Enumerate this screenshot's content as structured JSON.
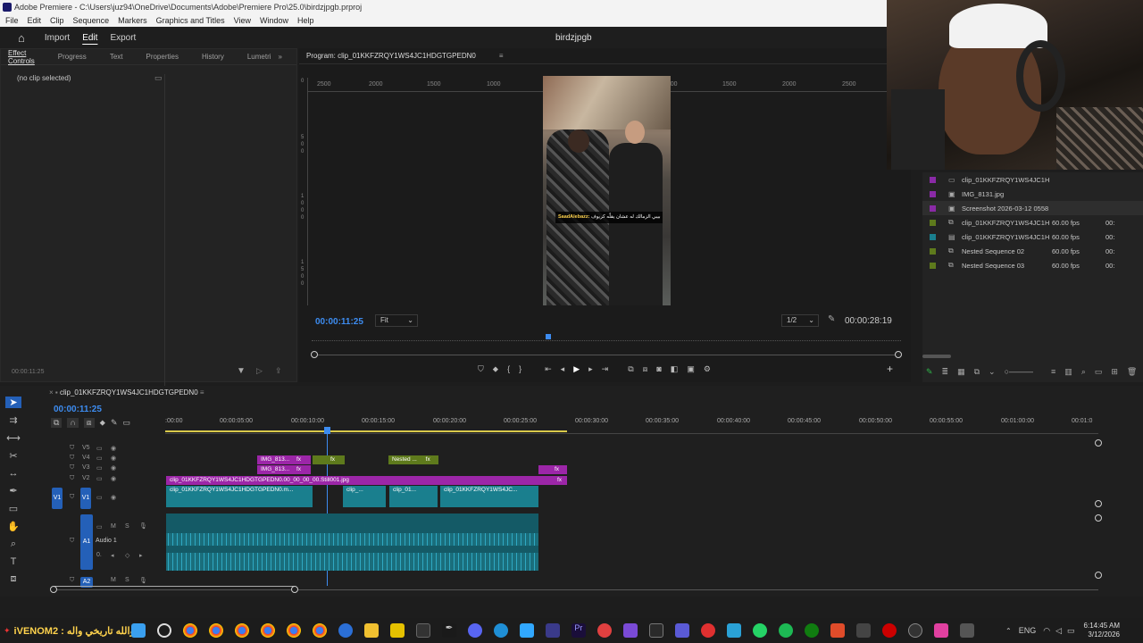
{
  "window": {
    "title": "Adobe Premiere - C:\\Users\\juz94\\OneDrive\\Documents\\Adobe\\Premiere Pro\\25.0\\birdzjpgb.prproj",
    "menu": [
      "File",
      "Edit",
      "Clip",
      "Sequence",
      "Markers",
      "Graphics and Titles",
      "View",
      "Window",
      "Help"
    ]
  },
  "topnav": {
    "import": "Import",
    "edit": "Edit",
    "export": "Export",
    "project_name": "birdzjpgb"
  },
  "left_panel": {
    "tabs": [
      "Effect Controls",
      "Progress",
      "Text",
      "Properties",
      "History",
      "Lumetri"
    ],
    "no_clip": "(no clip selected)",
    "timecode": "00:00:11:25"
  },
  "monitor": {
    "title": "Program: clip_01KKFZRQY1WS4JC1HDGTGPEDN0",
    "ruler_top": [
      "2500",
      "2000",
      "1500",
      "1000",
      "500",
      "0",
      "500",
      "1000",
      "1500",
      "2000",
      "2500"
    ],
    "ruler_left": [
      "0",
      "5",
      "0",
      "0",
      "1",
      "0",
      "0",
      "0",
      "1",
      "5",
      "0",
      "0"
    ],
    "current_time": "00:00:11:25",
    "fit": "Fit",
    "resolution": "1/2",
    "duration": "00:00:28:19",
    "caption_name": "SaadAlebazz:",
    "caption_text": "بيبي الزمالك له عشان يقلّه كريوف"
  },
  "project": {
    "items": [
      {
        "name": "clip_01KKFZRQY1WS4JC1H",
        "fps": "",
        "extra": "",
        "color": "#8a2aa6",
        "icon": "▭"
      },
      {
        "name": "IMG_8131.jpg",
        "fps": "",
        "extra": "",
        "color": "#8a2aa6",
        "icon": "▣"
      },
      {
        "name": "Screenshot 2026-03-12 0558",
        "fps": "",
        "extra": "",
        "color": "#8a2aa6",
        "icon": "▣"
      },
      {
        "name": "clip_01KKFZRQY1WS4JC1H",
        "fps": "60.00 fps",
        "extra": "00:",
        "color": "#5e7a1c",
        "icon": "⧉"
      },
      {
        "name": "clip_01KKFZRQY1WS4JC1H",
        "fps": "60.00 fps",
        "extra": "00:",
        "color": "#1a7f8e",
        "icon": "▤"
      },
      {
        "name": "Nested Sequence 02",
        "fps": "60.00 fps",
        "extra": "00:",
        "color": "#5e7a1c",
        "icon": "⧉"
      },
      {
        "name": "Nested Sequence 03",
        "fps": "60.00 fps",
        "extra": "00:",
        "color": "#5e7a1c",
        "icon": "⧉"
      }
    ]
  },
  "timeline": {
    "sequence_name": "clip_01KKFZRQY1WS4JC1HDGTGPEDN0",
    "current_time": "00:00:11:25",
    "ruler": [
      ":00:00",
      "00:00:05:00",
      "00:00:10:00",
      "00:00:15:00",
      "00:00:20:00",
      "00:00:25:00",
      "00:00:30:00",
      "00:00:35:00",
      "00:00:40:00",
      "00:00:45:00",
      "00:00:50:00",
      "00:00:55:00",
      "00:01:00:00",
      "00:01:0"
    ],
    "tracks": {
      "v5": "V5",
      "v4": "V4",
      "v3": "V3",
      "v2": "V2",
      "v1": "V1",
      "a1": "A1",
      "a2": "A2",
      "audio1": "Audio 1",
      "vol": "0."
    },
    "clips": {
      "v4_img": "IMG_813...",
      "v4_fx": "fx",
      "v4_g_fx": "fx",
      "v4_nested": "Nested ...",
      "v4_nested_fx": "fx",
      "v3_img": "IMG_813...",
      "v3_fx": "fx",
      "v3_end_fx": "fx",
      "v2_main": "clip_01KKFZRQY1WS4JC1HDGTGPEDN0.00_00_00_00.Still001.jpg",
      "v2_fx": "fx",
      "v1_a": "clip_01KKFZRQY1WS4JC1HDGTGPEDN0.m...",
      "v1_b": "clip_...",
      "v1_c": "clip_01...",
      "v1_d": "clip_01KKFZRQY1WS4JC..."
    }
  },
  "taskbar": {
    "left_text": "iVENOM2 : والله تاريخي واله",
    "lang": "ENG",
    "time": "6:14:45 AM",
    "date": "3/12/2026"
  }
}
